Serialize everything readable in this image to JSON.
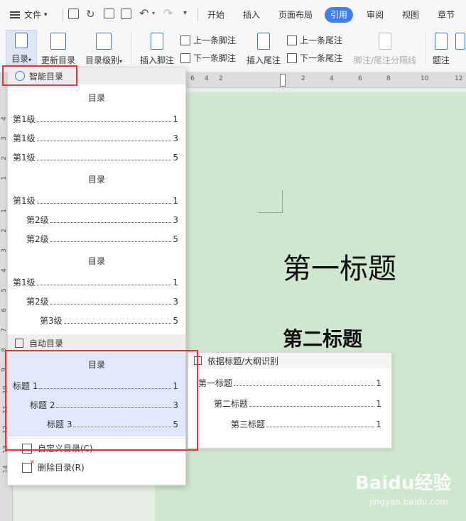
{
  "menubar": {
    "file_label": "文件",
    "tabs": [
      "开始",
      "插入",
      "页面布局",
      "引用",
      "审阅",
      "视图",
      "章节"
    ],
    "active_tab": "引用"
  },
  "ribbon": {
    "toc_label": "目录",
    "update_toc_label": "更新目录",
    "toc_level_label": "目录级别",
    "insert_footnote_label": "插入脚注",
    "prev_footnote_label": "上一条脚注",
    "next_footnote_label": "下一条脚注",
    "insert_endnote_label": "插入尾注",
    "prev_endnote_label": "上一条尾注",
    "next_endnote_label": "下一条尾注",
    "separator_label": "脚注/尾注分隔线",
    "caption_label": "题注"
  },
  "ruler": {
    "h_ticks": [
      "6",
      "4",
      "2",
      "2",
      "4",
      "6",
      "8",
      "10",
      "12"
    ],
    "v_ticks": [
      "4",
      "3",
      "2",
      "1",
      "1",
      "2",
      "3",
      "4",
      "5",
      "6",
      "7",
      "8",
      "9",
      "10",
      "11",
      "12",
      "13",
      "14"
    ]
  },
  "dropdown": {
    "smart_toc_label": "智能目录",
    "toc_a": {
      "title": "目录",
      "lines": [
        {
          "text": "第1级",
          "page": "1"
        },
        {
          "text": "第1级",
          "page": "3"
        },
        {
          "text": "第1级",
          "page": "5"
        }
      ]
    },
    "toc_b": {
      "title": "目录",
      "lines": [
        {
          "text": "第1级",
          "page": "1"
        },
        {
          "text": "第2级",
          "page": "3"
        },
        {
          "text": "第2级",
          "page": "5"
        }
      ]
    },
    "toc_c": {
      "title": "目录",
      "lines": [
        {
          "text": "第1级",
          "page": "1"
        },
        {
          "text": "第2级",
          "page": "3"
        },
        {
          "text": "第3级",
          "page": "5"
        }
      ]
    },
    "auto_toc_label": "自动目录",
    "toc_auto": {
      "title": "目录",
      "lines": [
        {
          "text": "标题 1",
          "page": "1"
        },
        {
          "text": "标题 2",
          "page": "3"
        },
        {
          "text": "标题 3",
          "page": "5"
        }
      ]
    },
    "custom_toc_label": "自定义目录(C)",
    "delete_toc_label": "删除目录(R)"
  },
  "popup": {
    "header": "依据标题/大纲识别",
    "lines": [
      {
        "text": "第一标题",
        "page": "1"
      },
      {
        "text": "第二标题",
        "page": "1"
      },
      {
        "text": "第三标题",
        "page": "1"
      }
    ]
  },
  "document": {
    "heading1": "第一标题",
    "heading2": "第二标题"
  },
  "watermark": {
    "brand": "Baidu经验",
    "url": "jingyan.baidu.com"
  },
  "colors": {
    "accent": "#3d7ff5",
    "highlight_box": "#e8333a",
    "page_bg": "#cfe6cf"
  }
}
